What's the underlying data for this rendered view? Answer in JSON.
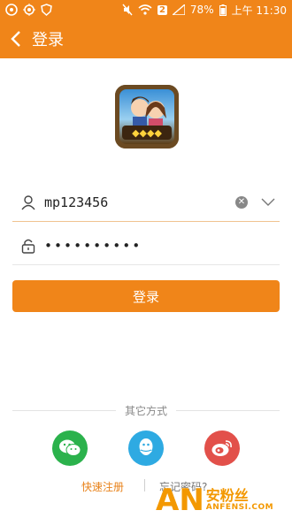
{
  "status_bar": {
    "battery": "78%",
    "time_label": "上午 11:30",
    "sim_label": "2"
  },
  "app_bar": {
    "title": "登录"
  },
  "login_form": {
    "username_value": "mp123456",
    "password_mask": "••••••••••",
    "login_label": "登录"
  },
  "other_methods": {
    "label": "其它方式",
    "icons": [
      "wechat-icon",
      "qq-icon",
      "weibo-icon"
    ]
  },
  "bottom_links": {
    "quick_register": "快速注册",
    "forgot_password": "忘记密码?"
  },
  "watermark": {
    "mark": "AN",
    "cn": "安粉丝",
    "en": "ANFENSI.COM"
  },
  "colors": {
    "accent": "#f08519",
    "wechat": "#2bb24c",
    "qq": "#2eaae2",
    "weibo": "#e2504a"
  }
}
